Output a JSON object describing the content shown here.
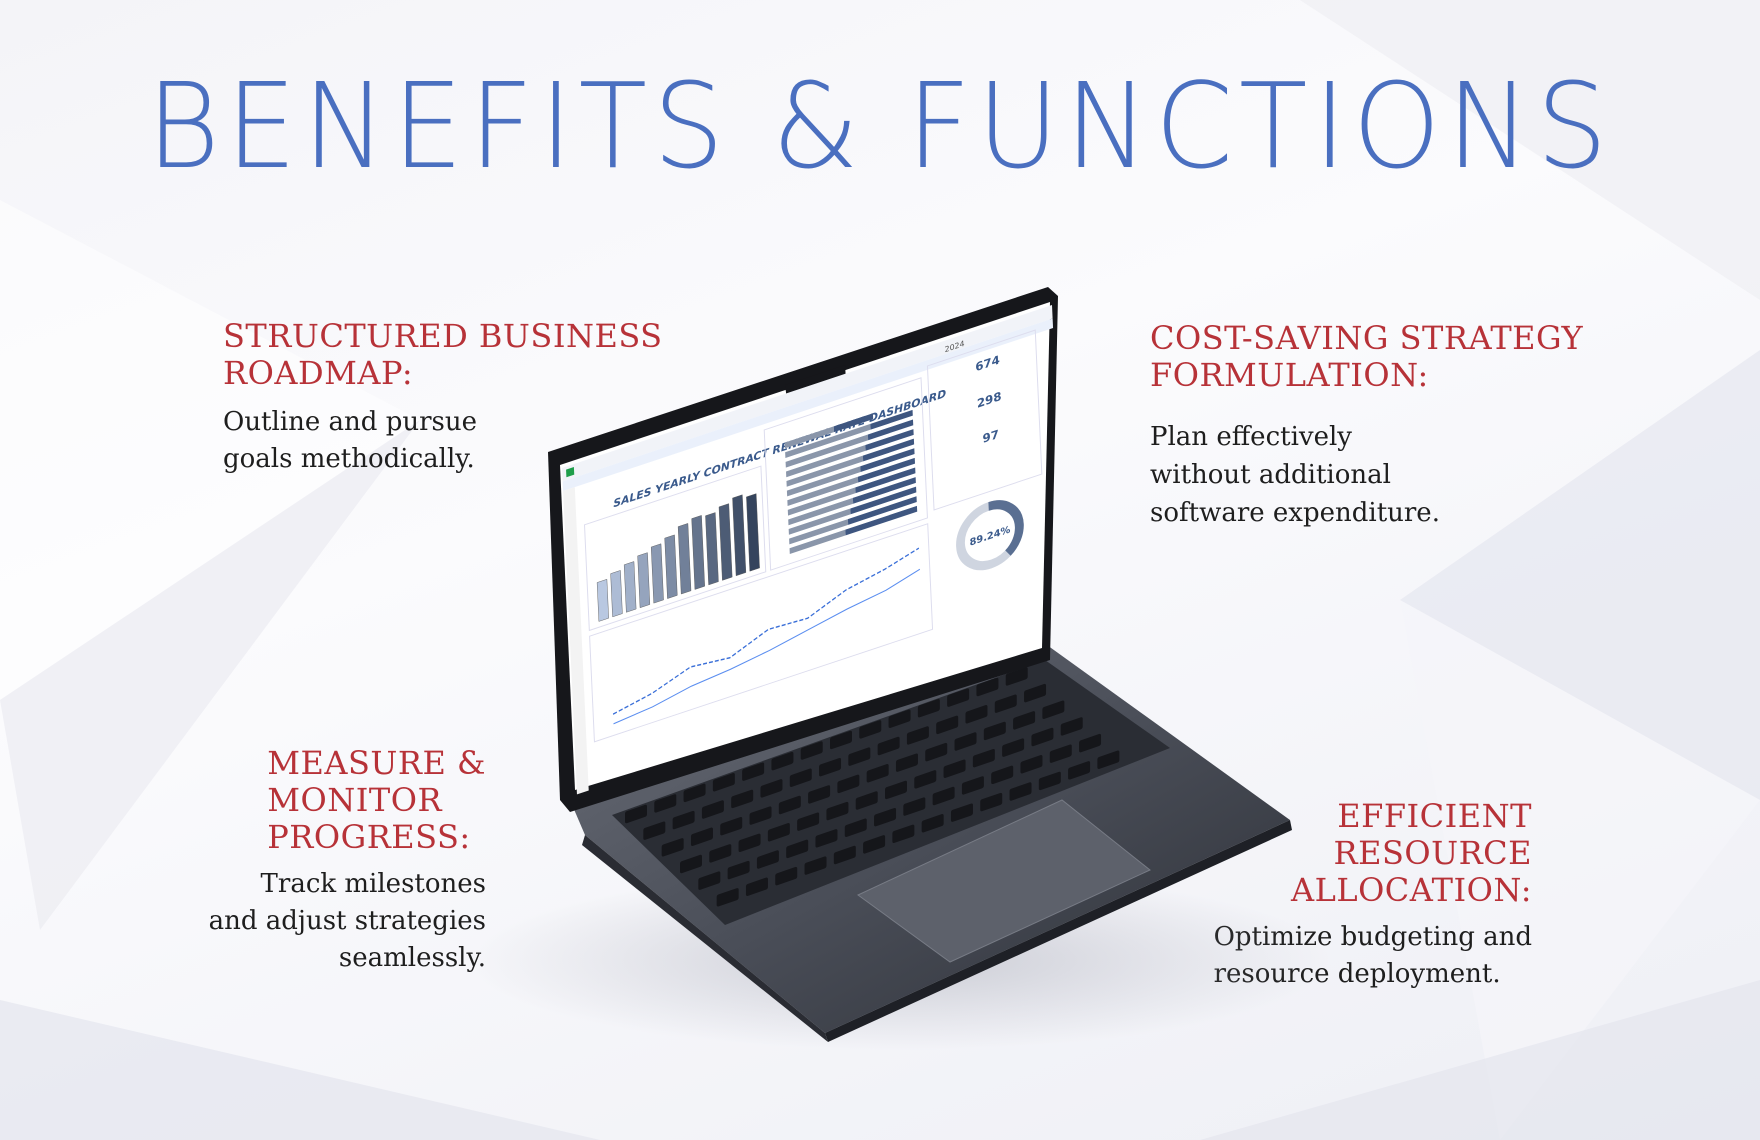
{
  "page": {
    "title": "BENEFITS & FUNCTIONS",
    "title_color": "#4a6fc0",
    "heading_color": "#b73238"
  },
  "benefits": [
    {
      "heading_lines": [
        "STRUCTURED BUSINESS",
        "ROADMAP:"
      ],
      "body_lines": [
        "Outline and pursue",
        "goals methodically."
      ]
    },
    {
      "heading_lines": [
        "COST-SAVING STRATEGY",
        "FORMULATION:"
      ],
      "body_lines": [
        "Plan effectively",
        "without additional",
        "software expenditure."
      ]
    },
    {
      "heading_lines": [
        "MEASURE &",
        "MONITOR",
        "PROGRESS:"
      ],
      "body_lines": [
        "Track milestones",
        "and adjust strategies",
        "seamlessly."
      ]
    },
    {
      "heading_lines": [
        "EFFICIENT",
        "RESOURCE",
        "ALLOCATION:"
      ],
      "body_lines": [
        "Optimize budgeting and",
        "resource deployment."
      ]
    }
  ],
  "laptop_screen": {
    "dashboard_title": "SALES YEARLY CONTRACT RENEWAL RATE DASHBOARD",
    "year_selector": "2024",
    "kpis": [
      "674",
      "298",
      "97"
    ],
    "renewal_rate": "89.24%",
    "renewal_rate_fraction": 0.8924,
    "monthly_bar_levels": [
      0.45,
      0.5,
      0.55,
      0.6,
      0.65,
      0.7,
      0.78,
      0.82,
      0.8,
      0.85,
      0.9,
      0.86
    ]
  }
}
